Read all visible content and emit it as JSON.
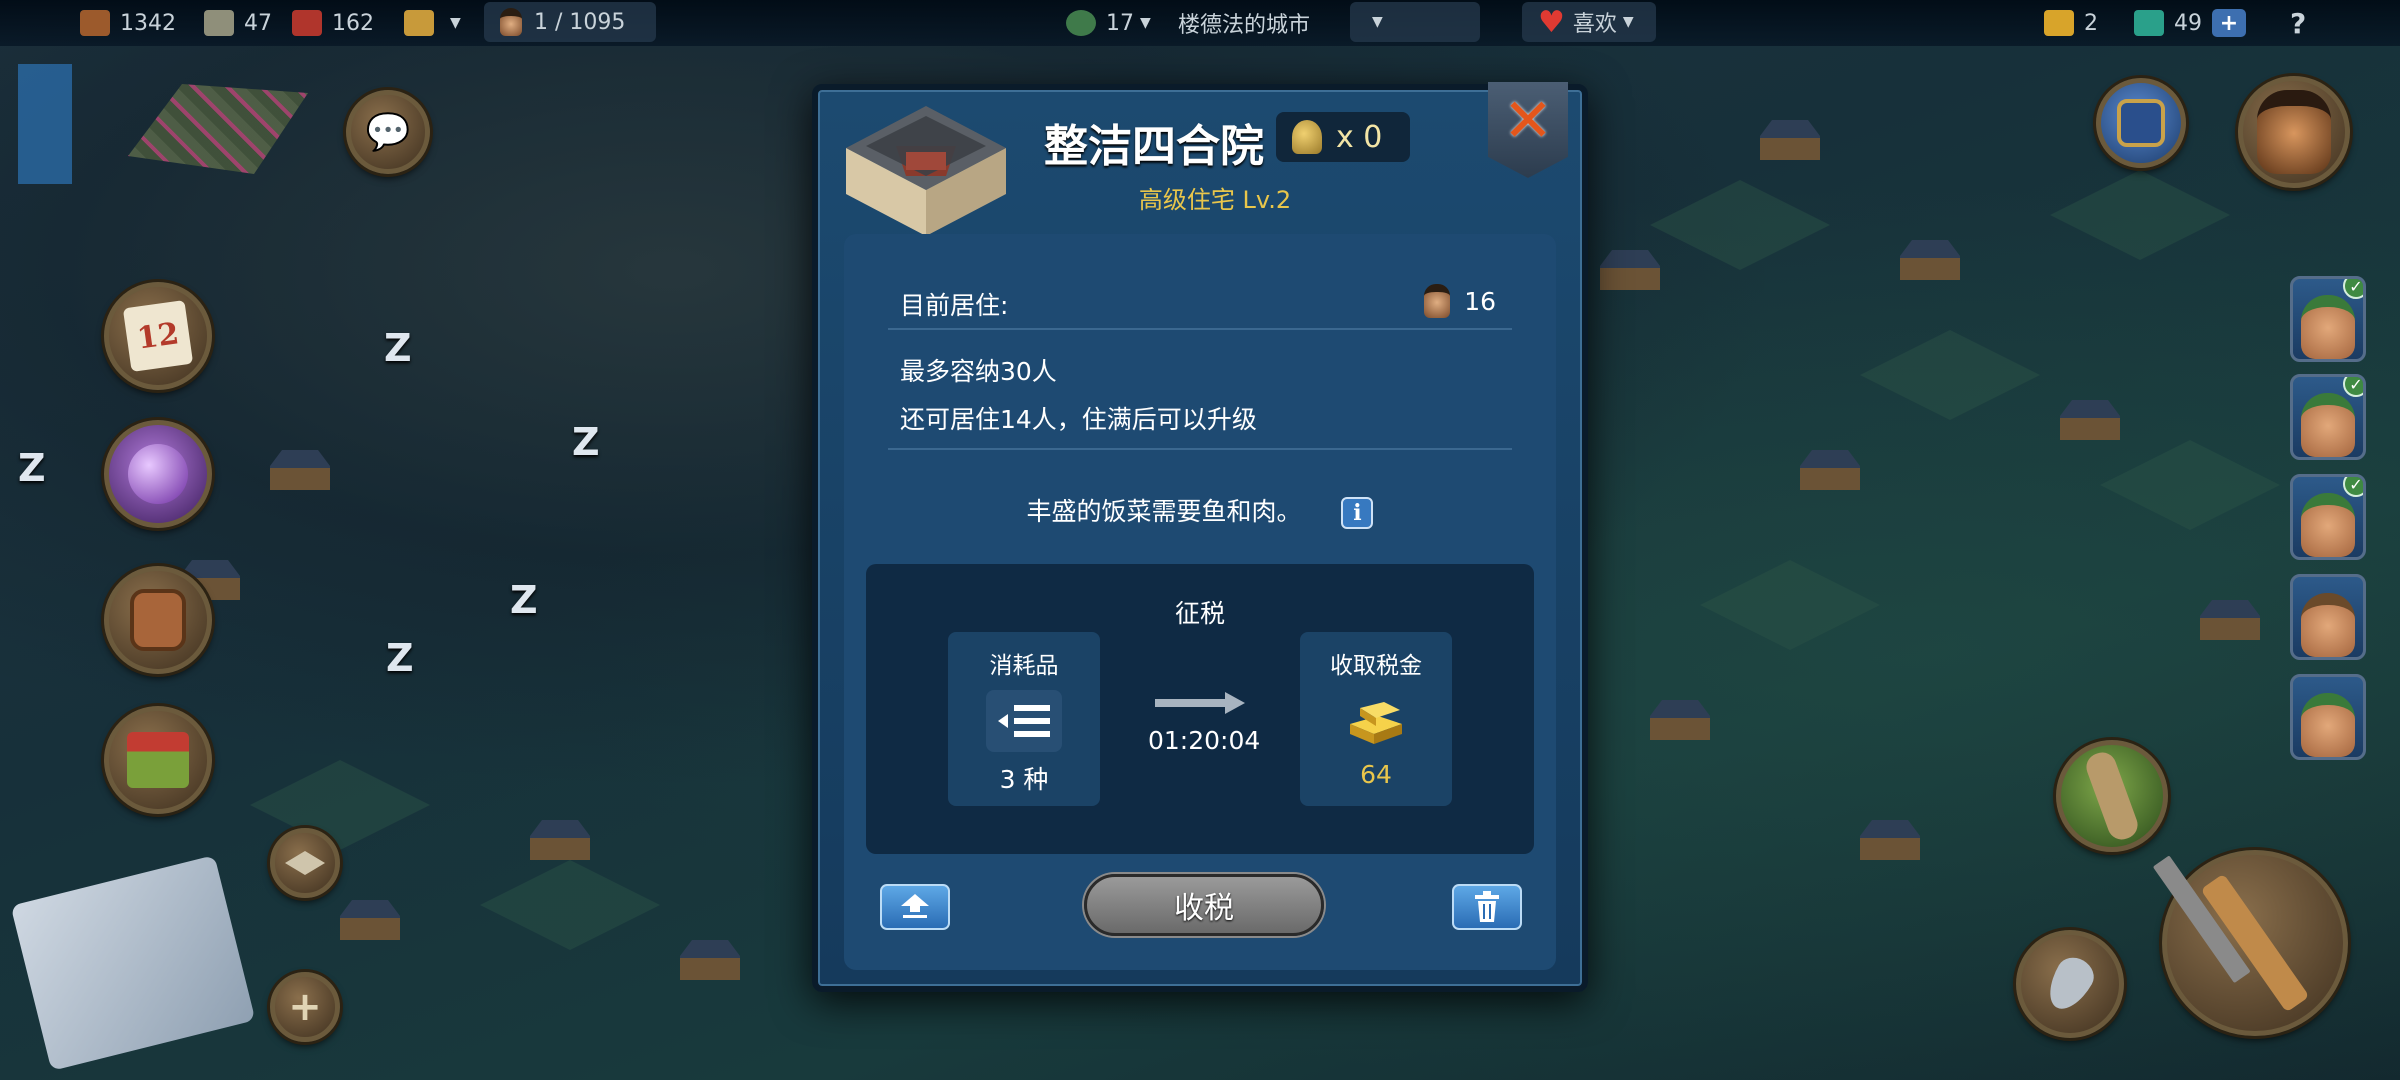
{
  "topbar": {
    "wood": "1342",
    "planks": "47",
    "bricks": "162",
    "population": "1 / 1095",
    "level": "17",
    "city_name": "楼德法的城市",
    "likes_label": "喜欢",
    "gold_bars": "2",
    "gems": "49",
    "help": "?"
  },
  "dialog": {
    "title": "整洁四合院",
    "soldier_count": "x 0",
    "subtitle": "高级住宅 Lv.2",
    "resident_label": "目前居住:",
    "resident_count": "16",
    "capacity": "最多容纳30人",
    "remaining": "还可居住14人，住满后可以升级",
    "note": "丰盛的饭菜需要鱼和肉。",
    "tax": {
      "title": "征税",
      "consumables_label": "消耗品",
      "consumables_value": "3 种",
      "timer": "01:20:04",
      "collect_label": "收取税金",
      "collect_value": "64"
    },
    "collect_button": "收税"
  },
  "calendar_day": "12",
  "colors": {
    "accent_gold": "#e9c64b",
    "close_red": "#e4561b",
    "dialog_blue": "#1c4a70"
  }
}
